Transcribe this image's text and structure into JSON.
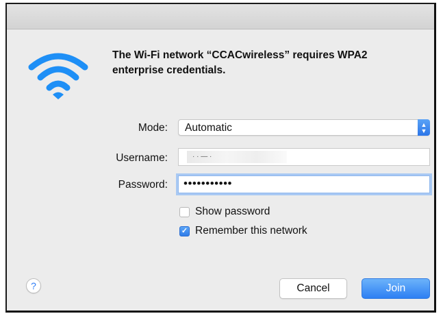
{
  "dialog": {
    "message": "The Wi-Fi network “CCACwireless” requires WPA2 enterprise credentials.",
    "icon": "wifi-icon"
  },
  "form": {
    "mode_label": "Mode:",
    "mode_value": "Automatic",
    "username_label": "Username:",
    "username_value": "· · — ·",
    "password_label": "Password:",
    "password_value": "•••••••••••"
  },
  "options": {
    "show_password": {
      "label": "Show password",
      "checked": false
    },
    "remember_network": {
      "label": "Remember this network",
      "checked": true
    }
  },
  "buttons": {
    "help": "?",
    "cancel": "Cancel",
    "join": "Join"
  },
  "colors": {
    "accent": "#2d7ff3",
    "wifi": "#1e8ff6",
    "window_bg": "#ececec"
  }
}
